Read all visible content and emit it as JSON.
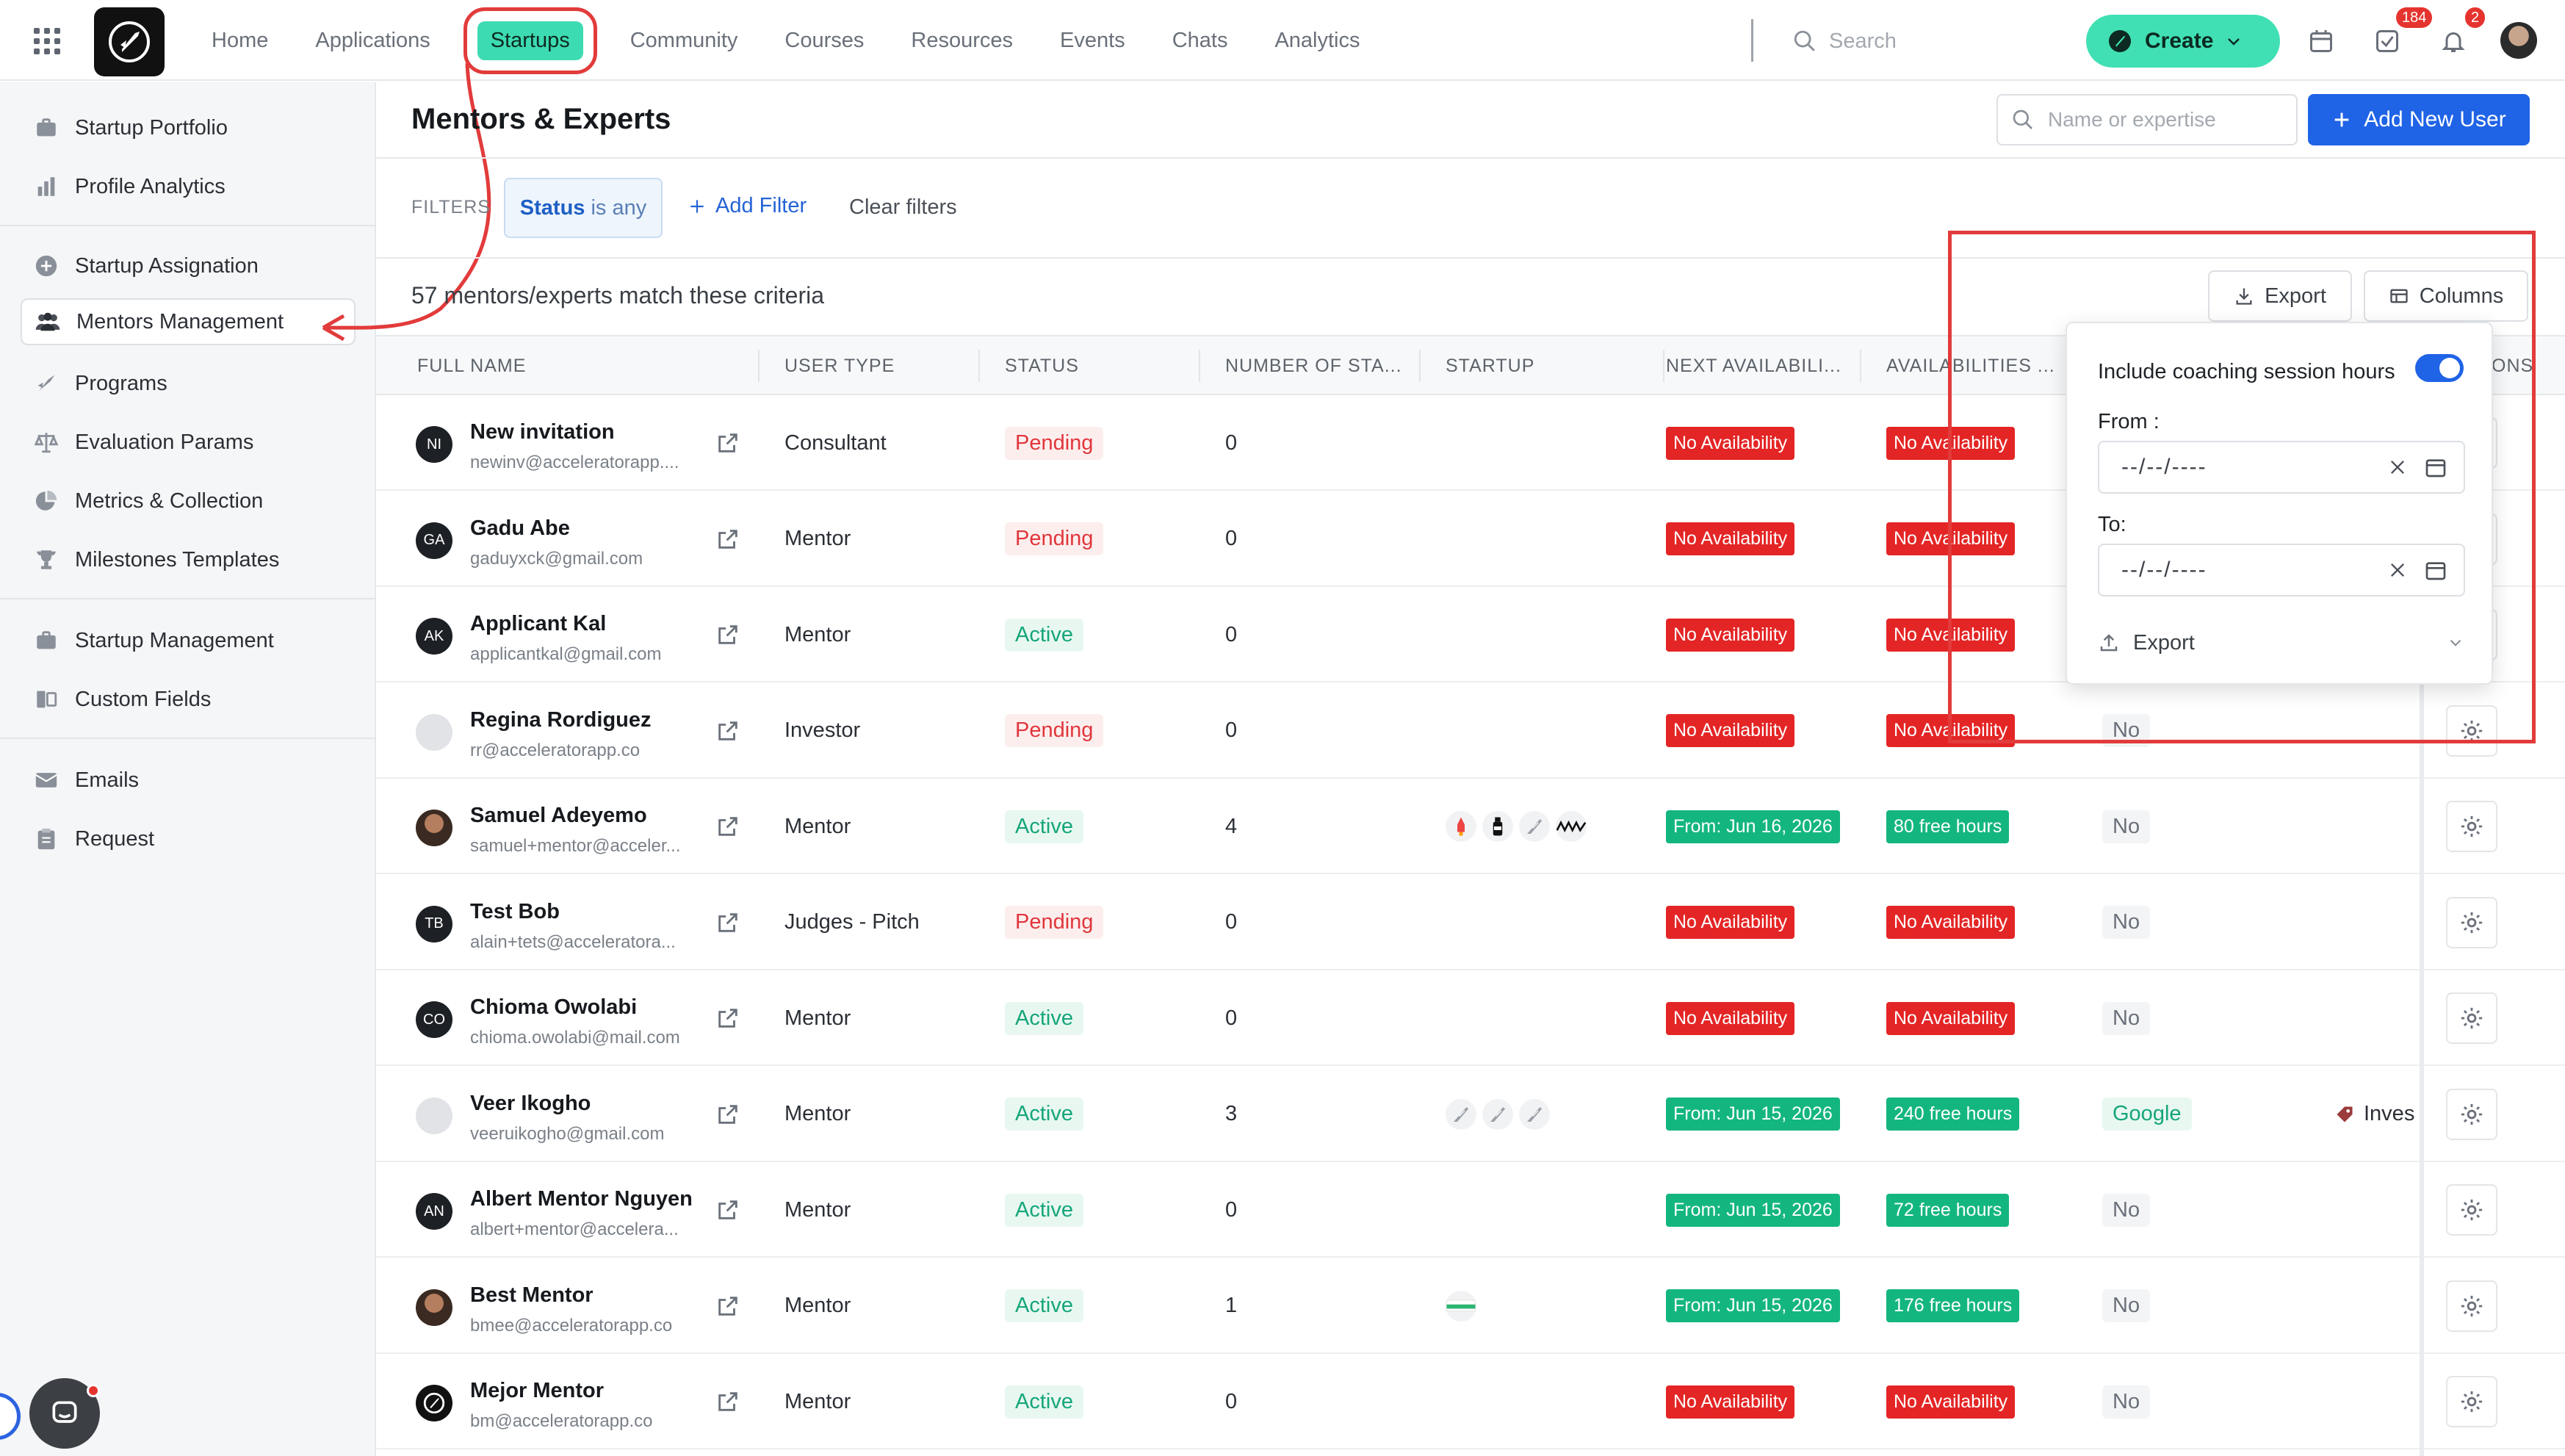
{
  "topnav": {
    "items": [
      "Home",
      "Applications",
      "Startups",
      "Community",
      "Courses",
      "Resources",
      "Events",
      "Chats",
      "Analytics"
    ],
    "active": "Startups",
    "search_placeholder": "Search",
    "create_label": "Create",
    "tasks_badge": "184",
    "notif_badge": "2"
  },
  "sidebar": {
    "items": [
      {
        "label": "Startup Portfolio",
        "icon": "briefcase-icon"
      },
      {
        "label": "Profile Analytics",
        "icon": "bar-chart-icon"
      },
      {
        "label": "Startup Assignation",
        "icon": "plus-circle-icon"
      },
      {
        "label": "Mentors Management",
        "icon": "users-icon"
      },
      {
        "label": "Programs",
        "icon": "rocket-icon"
      },
      {
        "label": "Evaluation Params",
        "icon": "scale-icon"
      },
      {
        "label": "Metrics & Collection",
        "icon": "pie-chart-icon"
      },
      {
        "label": "Milestones Templates",
        "icon": "trophy-icon"
      },
      {
        "label": "Startup Management",
        "icon": "briefcase-icon"
      },
      {
        "label": "Custom Fields",
        "icon": "fields-icon"
      },
      {
        "label": "Emails",
        "icon": "mail-icon"
      },
      {
        "label": "Request",
        "icon": "clipboard-icon"
      }
    ],
    "active": "Mentors Management"
  },
  "page": {
    "title": "Mentors & Experts",
    "search_placeholder": "Name or expertise",
    "add_user_label": "Add New User",
    "filters_label": "FILTERS",
    "status_filter_key": "Status",
    "status_filter_value": "is any",
    "add_filter_label": "Add Filter",
    "clear_filters_label": "Clear filters",
    "match_count": "57 mentors/experts match these criteria",
    "export_label": "Export",
    "columns_label": "Columns"
  },
  "table": {
    "columns": [
      "FULL NAME",
      "USER TYPE",
      "STATUS",
      "NUMBER OF STA...",
      "STARTUP",
      "NEXT AVAILABILI...",
      "AVAILABILITIES ...",
      "ONS"
    ],
    "rows": [
      {
        "initials": "NI",
        "avatar": "initials",
        "name": "New invitation",
        "email": "newinv@acceleratorapp....",
        "type": "Consultant",
        "status": "Pending",
        "count": "0",
        "startups": [],
        "next": "No Availability",
        "next_ok": false,
        "avail": "No Availability",
        "avail_ok": false,
        "col8": "",
        "col9": ""
      },
      {
        "initials": "GA",
        "avatar": "initials",
        "name": "Gadu Abe",
        "email": "gaduyxck@gmail.com",
        "type": "Mentor",
        "status": "Pending",
        "count": "0",
        "startups": [],
        "next": "No Availability",
        "next_ok": false,
        "avail": "No Availability",
        "avail_ok": false,
        "col8": "",
        "col9": ""
      },
      {
        "initials": "AK",
        "avatar": "initials",
        "name": "Applicant Kal",
        "email": "applicantkal@gmail.com",
        "type": "Mentor",
        "status": "Active",
        "count": "0",
        "startups": [],
        "next": "No Availability",
        "next_ok": false,
        "avail": "No Availability",
        "avail_ok": false,
        "col8": "",
        "col9": ""
      },
      {
        "initials": "",
        "avatar": "light",
        "name": "Regina Rordiguez",
        "email": "rr@acceleratorapp.co",
        "type": "Investor",
        "status": "Pending",
        "count": "0",
        "startups": [],
        "next": "No Availability",
        "next_ok": false,
        "avail": "No Availability",
        "avail_ok": false,
        "col8": "No",
        "col9": ""
      },
      {
        "initials": "",
        "avatar": "photo",
        "name": "Samuel Adeyemo",
        "email": "samuel+mentor@acceler...",
        "type": "Mentor",
        "status": "Active",
        "count": "4",
        "startups": [
          "rocket-logo-icon",
          "bottle-logo-icon",
          "feather-logo-icon",
          "wordmark-logo-icon"
        ],
        "next": "From: Jun 16, 2026",
        "next_ok": true,
        "avail": "80 free hours",
        "avail_ok": true,
        "col8": "No",
        "col9": ""
      },
      {
        "initials": "TB",
        "avatar": "initials",
        "name": "Test Bob",
        "email": "alain+tets@acceleratora...",
        "type": "Judges - Pitch",
        "status": "Pending",
        "count": "0",
        "startups": [],
        "next": "No Availability",
        "next_ok": false,
        "avail": "No Availability",
        "avail_ok": false,
        "col8": "No",
        "col9": ""
      },
      {
        "initials": "CO",
        "avatar": "initials",
        "name": "Chioma Owolabi",
        "email": "chioma.owolabi@mail.com",
        "type": "Mentor",
        "status": "Active",
        "count": "0",
        "startups": [],
        "next": "No Availability",
        "next_ok": false,
        "avail": "No Availability",
        "avail_ok": false,
        "col8": "No",
        "col9": ""
      },
      {
        "initials": "",
        "avatar": "light",
        "name": "Veer Ikogho",
        "email": "veeruikogho@gmail.com",
        "type": "Mentor",
        "status": "Active",
        "count": "3",
        "startups": [
          "feather-logo-icon",
          "feather-logo-icon",
          "feather-logo-icon"
        ],
        "next": "From: Jun 15, 2026",
        "next_ok": true,
        "avail": "240 free hours",
        "avail_ok": true,
        "col8": "Google",
        "col9": "Inves"
      },
      {
        "initials": "AN",
        "avatar": "initials",
        "name": "Albert Mentor Nguyen",
        "email": "albert+mentor@accelera...",
        "type": "Mentor",
        "status": "Active",
        "count": "0",
        "startups": [],
        "next": "From: Jun 15, 2026",
        "next_ok": true,
        "avail": "72 free hours",
        "avail_ok": true,
        "col8": "No",
        "col9": ""
      },
      {
        "initials": "",
        "avatar": "photo",
        "name": "Best Mentor",
        "email": "bmee@acceleratorapp.co",
        "type": "Mentor",
        "status": "Active",
        "count": "1",
        "startups": [
          "flag-logo-icon"
        ],
        "next": "From: Jun 15, 2026",
        "next_ok": true,
        "avail": "176 free hours",
        "avail_ok": true,
        "col8": "No",
        "col9": ""
      },
      {
        "initials": "",
        "avatar": "rocket",
        "name": "Mejor Mentor",
        "email": "bm@acceleratorapp.co",
        "type": "Mentor",
        "status": "Active",
        "count": "0",
        "startups": [],
        "next": "No Availability",
        "next_ok": false,
        "avail": "No Availability",
        "avail_ok": false,
        "col8": "No",
        "col9": ""
      }
    ]
  },
  "export_popover": {
    "toggle_label": "Include coaching session hours",
    "toggle_on": true,
    "from_label": "From :",
    "to_label": "To:",
    "date_placeholder": "--/--/----",
    "export_label": "Export"
  },
  "colors": {
    "accent_teal": "#3ddbb1",
    "primary_blue": "#1f63e6",
    "danger_red": "#e42525",
    "success_green": "#14b67f",
    "annotation_red": "#e23b3b"
  }
}
